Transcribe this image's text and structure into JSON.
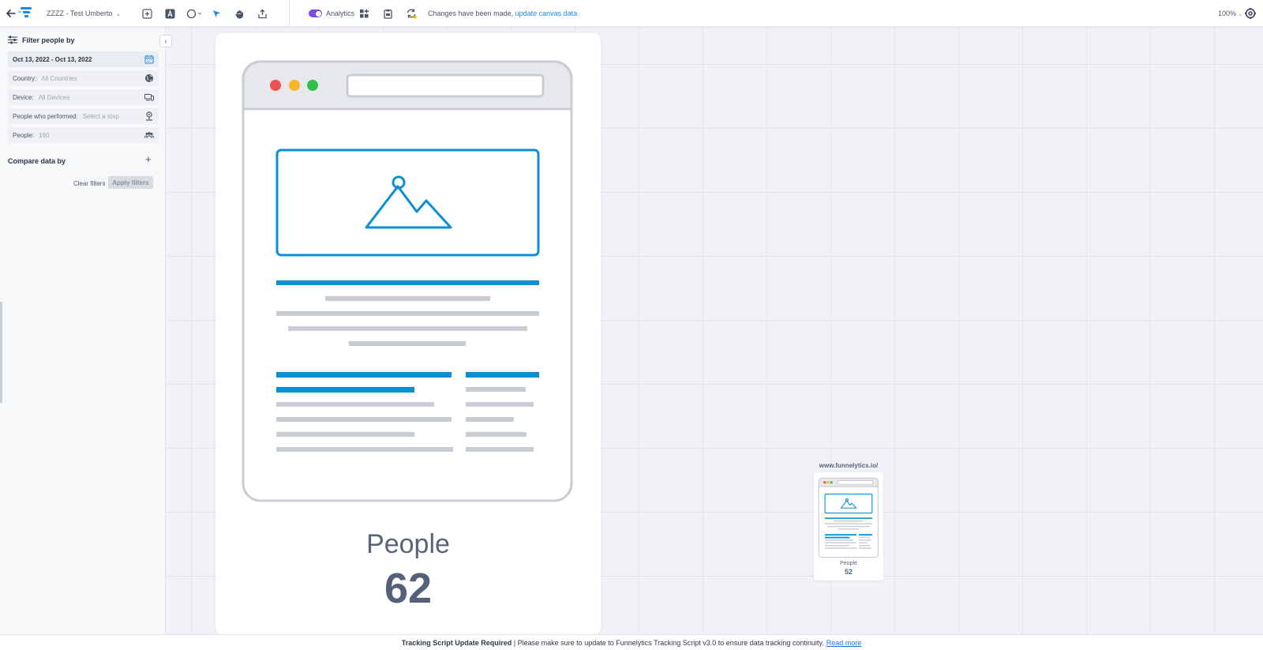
{
  "topbar": {
    "project_name": "ZZZZ - Test Umberto",
    "analytics_label": "Analytics",
    "changes_text": "Changes have been made,",
    "changes_link": "update canvas data",
    "zoom": "100%"
  },
  "sidebar": {
    "filter_title": "Filter people by",
    "date_range": "Oct 13, 2022 - Oct 13, 2022",
    "filters": [
      {
        "label": "Country:",
        "value": "All Countries"
      },
      {
        "label": "Device:",
        "value": "All Devices"
      },
      {
        "label": "People who performed:",
        "value": "Select a step"
      },
      {
        "label": "People:",
        "value": "160"
      }
    ],
    "compare_title": "Compare data by",
    "clear_label": "Clear filters",
    "apply_label": "Apply filters"
  },
  "canvas": {
    "main_node": {
      "people_label": "People",
      "people_value": "62"
    },
    "small_node": {
      "url": "www.funnelytics.io/",
      "people_label": "People",
      "people_value": "52"
    }
  },
  "banner": {
    "title": "Tracking Script Update Required",
    "message": "| Please make sure to update to Funnelytics Tracking Script v3.0 to ensure data tracking continuity.",
    "link": "Read more"
  },
  "colors": {
    "accent": "#1e88e5",
    "toggle": "#7c4ddc",
    "page_blue": "#0b8fd4",
    "mock_gray": "#c8ccd3"
  }
}
